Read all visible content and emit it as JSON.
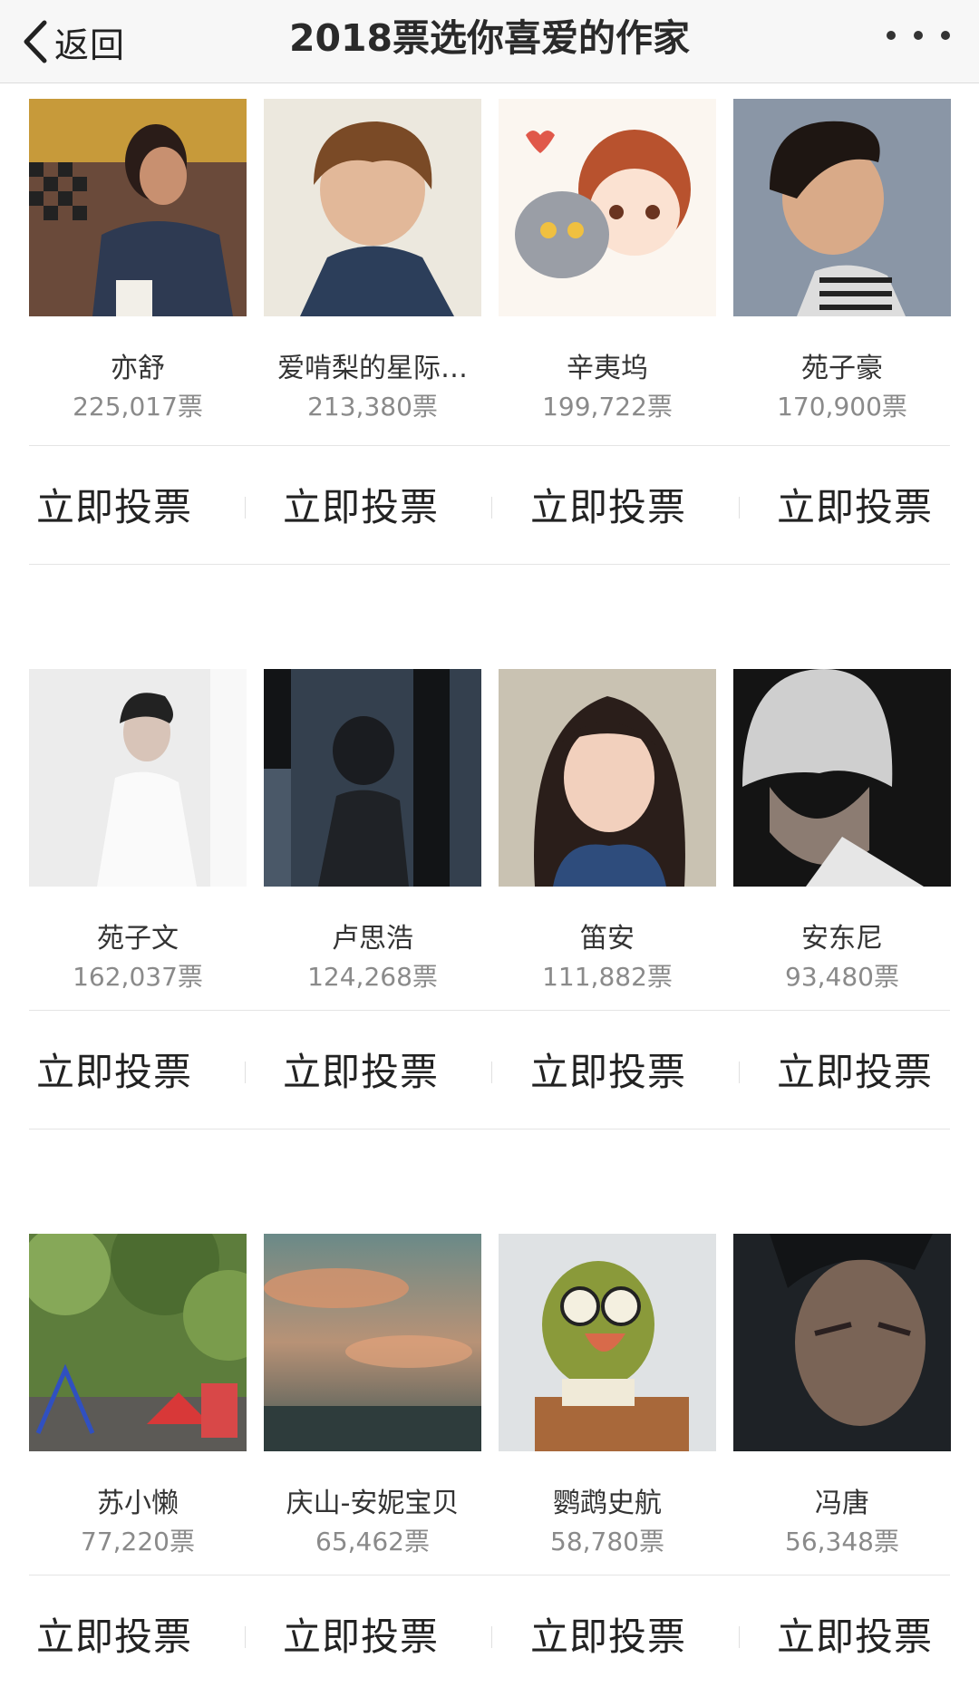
{
  "nav": {
    "back_label": "返回",
    "title": "2018票选你喜爱的作家",
    "more_icon": "more-dots-icon"
  },
  "vote_label": "立即投票",
  "authors": [
    {
      "name": "亦舒",
      "votes": "225,017票"
    },
    {
      "name": "爱啃梨的星际…",
      "votes": "213,380票"
    },
    {
      "name": "辛夷坞",
      "votes": "199,722票"
    },
    {
      "name": "苑子豪",
      "votes": "170,900票"
    },
    {
      "name": "苑子文",
      "votes": "162,037票"
    },
    {
      "name": "卢思浩",
      "votes": "124,268票"
    },
    {
      "name": "笛安",
      "votes": "111,882票"
    },
    {
      "name": "安东尼",
      "votes": "93,480票"
    },
    {
      "name": "苏小懒",
      "votes": "77,220票"
    },
    {
      "name": "庆山-安妮宝贝",
      "votes": "65,462票"
    },
    {
      "name": "鹦鹉史航",
      "votes": "58,780票"
    },
    {
      "name": "冯唐",
      "votes": "56,348票"
    }
  ]
}
